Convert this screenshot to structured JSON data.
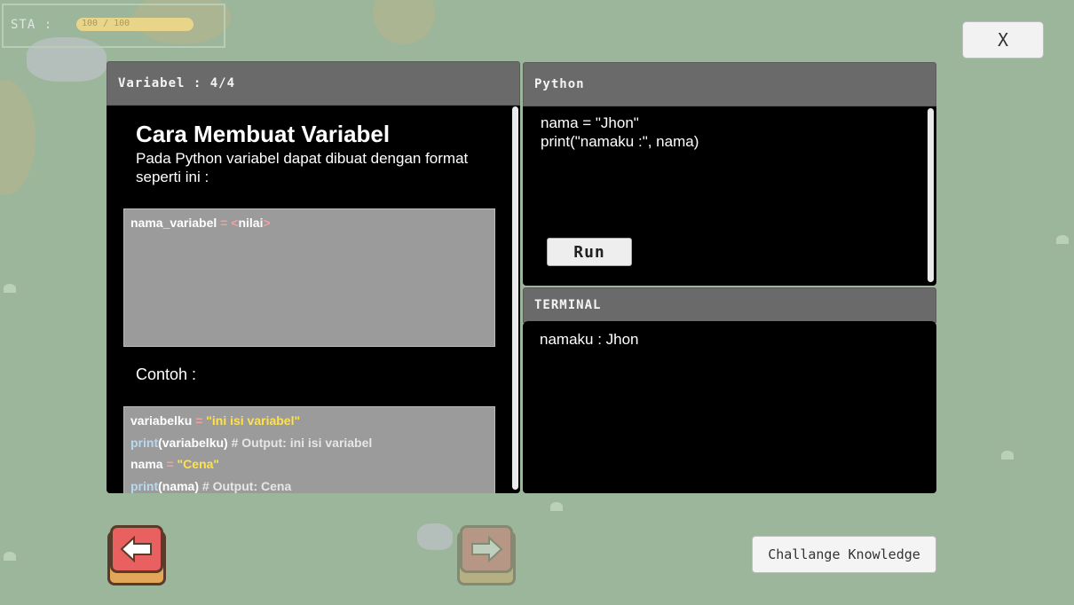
{
  "hud": {
    "stamina_label": "STA :",
    "stamina_text": "100 / 100",
    "stamina_fraction": 1.0
  },
  "close_label": "X",
  "lesson": {
    "header": "Variabel : 4/4",
    "title": "Cara Membuat Variabel",
    "description": "Pada Python variabel dapat dibuat dengan format seperti ini :",
    "syntax": {
      "name": "nama_variabel",
      "op": " = ",
      "lt": "<",
      "value": "nilai",
      "gt": ">"
    },
    "example_label": "Contoh :",
    "example": {
      "l1_var": "variabelku",
      "l1_op": " = ",
      "l1_str": "\"ini isi variabel\"",
      "l2_fn": "print",
      "l2_args": "(variabelku)",
      "l2_comment": " # Output: ini isi variabel",
      "l3_var": "nama",
      "l3_op": " = ",
      "l3_str": "\"Cena\"",
      "l4_fn": "print",
      "l4_args": "(nama)",
      "l4_comment": " # Output: Cena"
    }
  },
  "editor": {
    "header": "Python",
    "code": "nama = \"Jhon\"\nprint(\"namaku :\", nama)",
    "run_label": "Run"
  },
  "terminal": {
    "header": "TERMINAL",
    "output": "namaku : Jhon"
  },
  "nav": {
    "challenge_label": "Challange Knowledge"
  },
  "colors": {
    "panel_header": "#6a6a6a",
    "panel_body": "#000000",
    "code_bg": "#9b9b9b",
    "string": "#ffe24a",
    "operator": "#f2a0a0",
    "builtin": "#b9d9f0"
  }
}
